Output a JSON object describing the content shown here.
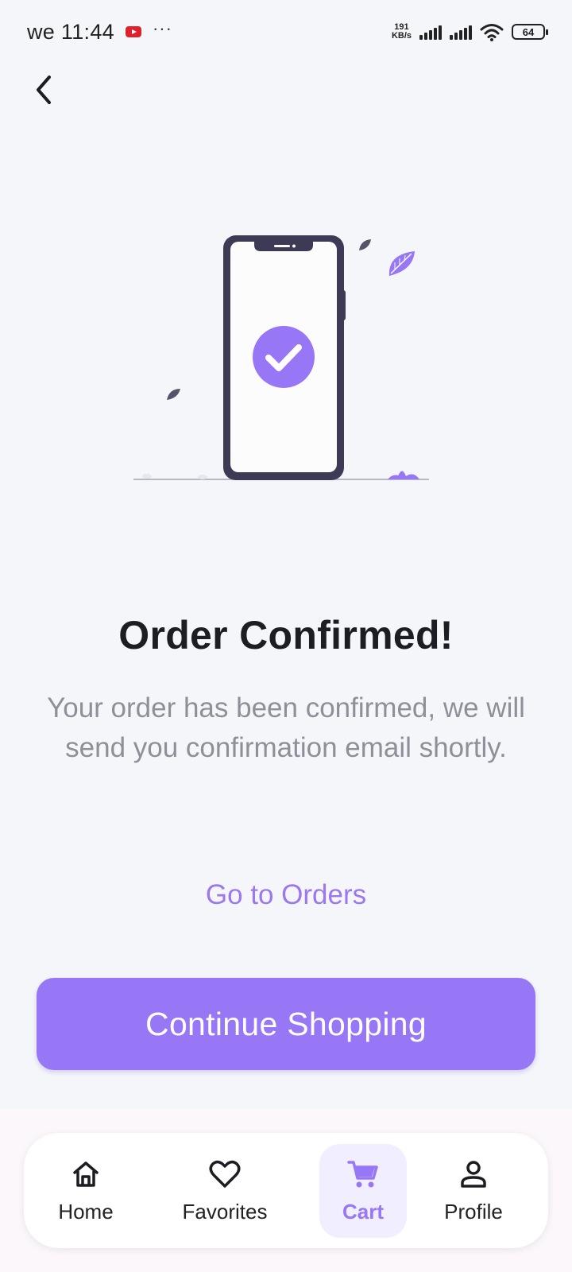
{
  "status_bar": {
    "time": "we 11:44",
    "dots": "···",
    "net_speed_value": "191",
    "net_speed_unit": "KB/s",
    "battery": "64"
  },
  "header": {
    "back_icon": "chevron-left-icon"
  },
  "illustration": {
    "icon": "check-circle-icon",
    "accent_color": "#9877f7"
  },
  "content": {
    "title": "Order Confirmed!",
    "message": "Your order has been confirmed, we will send you confirmation email shortly.",
    "orders_link": "Go to Orders",
    "continue_button": "Continue Shopping"
  },
  "bottom_nav": {
    "items": [
      {
        "label": "Home",
        "icon": "home-icon",
        "active": false
      },
      {
        "label": "Favorites",
        "icon": "heart-icon",
        "active": false
      },
      {
        "label": "Cart",
        "icon": "cart-icon",
        "active": true
      },
      {
        "label": "Profile",
        "icon": "person-icon",
        "active": false
      }
    ]
  },
  "colors": {
    "accent": "#9877f7",
    "background": "#f5f6fa",
    "text_primary": "#1d1d24",
    "text_secondary": "#8e9099"
  }
}
